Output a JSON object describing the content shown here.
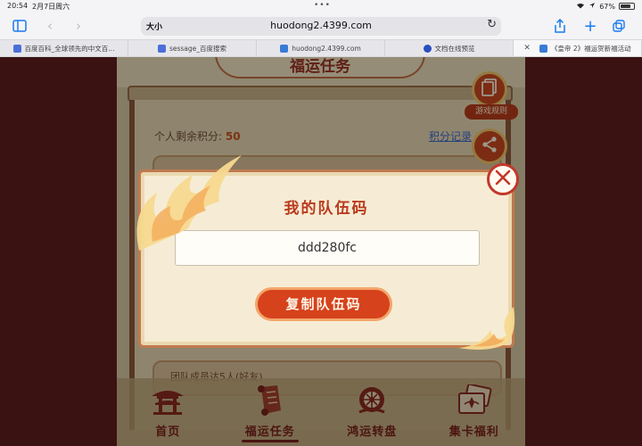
{
  "status": {
    "time": "20:54",
    "date": "2月7日周六",
    "battery": "67%"
  },
  "browser": {
    "text_size_label": "大小",
    "url": "huodong2.4399.com",
    "tabs": [
      {
        "label": "百度百科_全球领先的中文百..."
      },
      {
        "label": "sessage_百度搜索"
      },
      {
        "label": "huodong2.4399.com"
      },
      {
        "label": "文档在线预览"
      },
      {
        "label": "《皇帝 2》福运贺新福活动"
      }
    ]
  },
  "page": {
    "title": "福运任务",
    "points_label": "个人剩余积分:",
    "points_value": "50",
    "records_link": "积分记录",
    "rules_label": "游戏规则",
    "share_icon": "share-icon",
    "rules_icon": "document-icon",
    "row2_text": "团队成员达5人(好友)"
  },
  "modal": {
    "title": "我的队伍码",
    "team_code": "ddd280fc",
    "copy_button": "复制队伍码",
    "close_icon": "close-icon"
  },
  "bottom_nav": [
    {
      "label": "首页",
      "icon": "pavilion-icon"
    },
    {
      "label": "福运任务",
      "icon": "scroll-icon"
    },
    {
      "label": "鸿运转盘",
      "icon": "wheel-icon"
    },
    {
      "label": "集卡福利",
      "icon": "cards-icon"
    }
  ],
  "colors": {
    "accent": "#ba3a1e",
    "nav_text": "#7a231b",
    "link": "#3b66c9"
  }
}
